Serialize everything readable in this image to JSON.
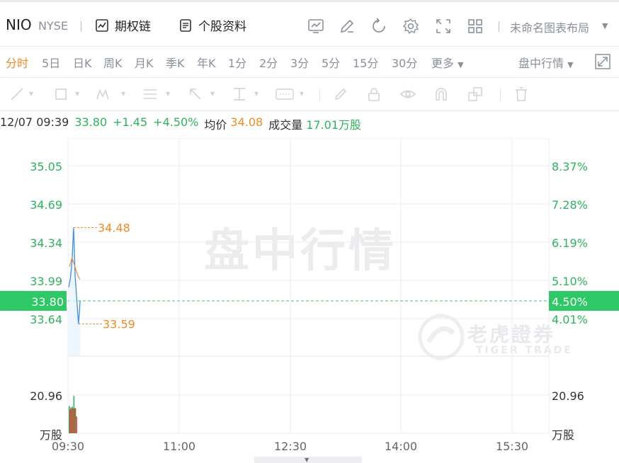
{
  "header": {
    "symbol": "NIO",
    "exchange": "NYSE",
    "option_chain": "期权链",
    "profile": "个股资料",
    "layout_name": "未命名图表布局",
    "icons": [
      "chart-template-icon",
      "edit-icon",
      "refresh-icon",
      "settings-icon",
      "fullscreen-icon",
      "grid-layout-icon"
    ]
  },
  "tabs": {
    "items": [
      "分时",
      "5日",
      "日K",
      "周K",
      "月K",
      "季K",
      "年K",
      "1分",
      "2分",
      "3分",
      "5分",
      "15分",
      "30分",
      "更多"
    ],
    "active": "分时",
    "market": "盘中行情"
  },
  "quote": {
    "datetime": "12/07 09:39",
    "price": "33.80",
    "change": "+1.45",
    "change_pct": "+4.50%",
    "avg_label": "均价",
    "avg_value": "34.08",
    "volume_label": "成交量",
    "volume_value": "17.01万股"
  },
  "chart_data": {
    "type": "line",
    "watermark": "盘中行情",
    "logo": "老虎證券",
    "logo_sub": "TIGER TRADE",
    "x_ticks": [
      "09:30",
      "11:00",
      "12:30",
      "14:00",
      "15:30"
    ],
    "y_ticks_left": [
      "35.05",
      "34.69",
      "34.34",
      "33.99",
      "33.64"
    ],
    "y_ticks_right": [
      "8.37%",
      "7.28%",
      "6.19%",
      "5.10%",
      "4.01%"
    ],
    "ylim": [
      33.45,
      35.3
    ],
    "current_price": "33.80",
    "current_pct": "4.50%",
    "high_label": "34.48",
    "low_label": "33.59",
    "high": 34.48,
    "low": 33.59,
    "price_series": [
      33.93,
      34.01,
      34.16,
      34.48,
      34.02,
      33.81,
      33.59,
      33.8
    ],
    "avg_series": [
      34.12,
      34.2,
      34.13,
      34.05,
      34.0
    ],
    "volume_max_label": "20.96",
    "volume_unit": "万股",
    "volume_max": 20.96,
    "volume_up": [
      15.0,
      14.2,
      14.6,
      20.5,
      13.8
    ],
    "volume_down": [
      13.0,
      13.6,
      13.7,
      13.8,
      9.2
    ]
  },
  "colors": {
    "up": "#2db35d",
    "down": "#e0483b",
    "price_line": "#3d8ee8",
    "avg_line": "#f08a24",
    "label_green_bg": "#2ec866"
  }
}
